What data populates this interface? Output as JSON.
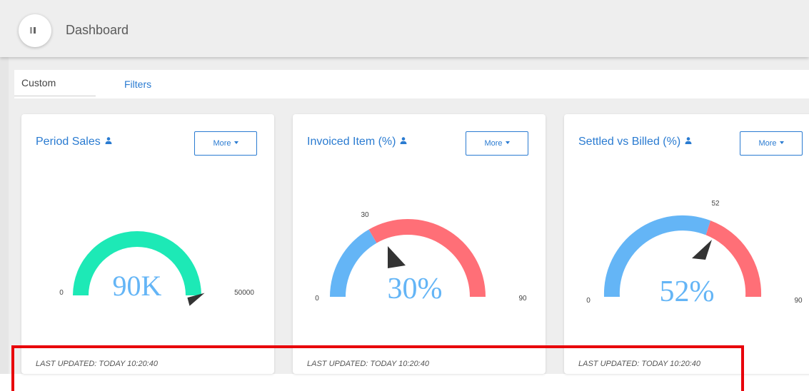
{
  "header": {
    "title": "Dashboard"
  },
  "filter_bar": {
    "tab_custom": "Custom",
    "tab_filters": "Filters"
  },
  "colors": {
    "accent": "#2a7bd1",
    "teal": "#1de9b6",
    "blue": "#64b5f6",
    "red": "#ff6f77"
  },
  "cards": [
    {
      "title": "Period Sales",
      "more": "More",
      "min": "0",
      "max": "50000",
      "mark": "",
      "value": "90K",
      "updated": "LAST UPDATED: TODAY 10:20:40"
    },
    {
      "title": "Invoiced Item (%)",
      "more": "More",
      "min": "0",
      "max": "90",
      "mark": "30",
      "value": "30%",
      "updated": "LAST UPDATED: TODAY 10:20:40"
    },
    {
      "title": "Settled vs Billed (%)",
      "more": "More",
      "min": "0",
      "max": "90",
      "mark": "52",
      "value": "52%",
      "updated": "LAST UPDATED: TODAY 10:20:40"
    }
  ]
}
